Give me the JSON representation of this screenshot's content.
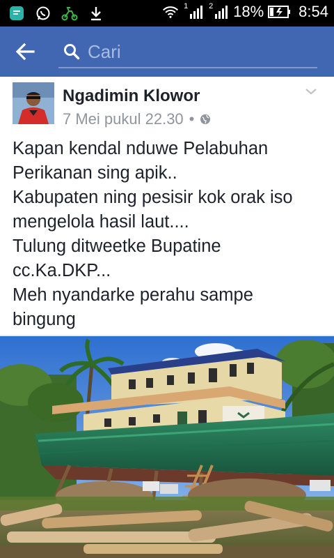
{
  "status_bar": {
    "battery_percent": "18%",
    "time": "8:54",
    "sim1_label": "1",
    "sim2_label": "2",
    "icons": [
      "message-icon",
      "whatsapp-icon",
      "scooter-icon",
      "download-icon",
      "wifi-icon",
      "signal-icon",
      "signal-icon",
      "battery-charging-icon"
    ]
  },
  "app_bar": {
    "search_placeholder": "Cari",
    "accent_color": "#4267b2"
  },
  "post": {
    "author": "Ngadimin Klowor",
    "timestamp": "7 Mei pukul 22.30",
    "separator": "•",
    "privacy_icon": "globe-icon",
    "lines": [
      "Kapan kendal nduwe Pelabuhan",
      "Perikanan sing apik..",
      "Kabupaten ning pesisir kok orak iso",
      "mengelola hasil laut....",
      "Tulung ditweetke Bupatine",
      "cc.Ka.DKP...",
      "Meh nyandarke perahu sampe",
      "bingung"
    ]
  }
}
